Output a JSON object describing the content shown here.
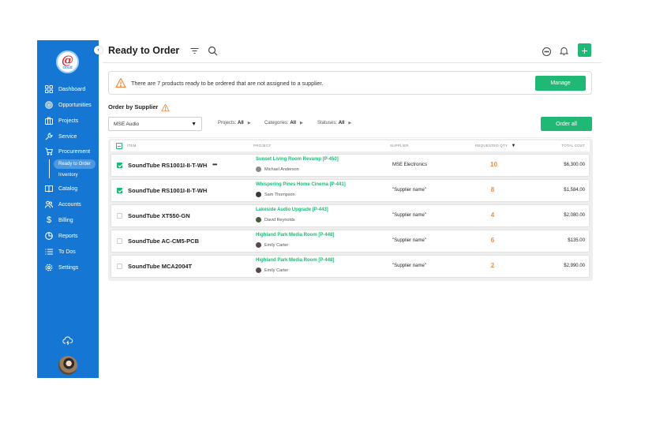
{
  "sidebar": {
    "logo_text": "@",
    "logo_sub": "cloud",
    "collapse_icon": "chevron-left-icon",
    "items": [
      {
        "label": "Dashboard",
        "icon": "grid-icon"
      },
      {
        "label": "Opportunities",
        "icon": "target-icon"
      },
      {
        "label": "Projects",
        "icon": "briefcase-icon"
      },
      {
        "label": "Service",
        "icon": "wrench-icon"
      },
      {
        "label": "Procurement",
        "icon": "cart-icon"
      },
      {
        "label": "Catalog",
        "icon": "book-icon"
      },
      {
        "label": "Accounts",
        "icon": "users-icon"
      },
      {
        "label": "Billing",
        "icon": "dollar-icon"
      },
      {
        "label": "Reports",
        "icon": "pie-chart-icon"
      },
      {
        "label": "To Dos",
        "icon": "list-icon"
      },
      {
        "label": "Settings",
        "icon": "gear-icon"
      }
    ],
    "subitems": [
      {
        "label": "Ready to Order",
        "active": true
      },
      {
        "label": "Inventory",
        "active": false
      }
    ]
  },
  "header": {
    "title": "Ready to Order",
    "add_label": "+"
  },
  "alert": {
    "message": "There are 7 products ready to be ordered that are not assigned to a supplier.",
    "manage_label": "Manage"
  },
  "order_by_supplier": {
    "title": "Order by Supplier",
    "selected_supplier": "MSE Audio",
    "filters": [
      {
        "label": "Projects:",
        "value": "All"
      },
      {
        "label": "Categories:",
        "value": "All"
      },
      {
        "label": "Statuses:",
        "value": "All"
      }
    ],
    "order_all_label": "Order all"
  },
  "table": {
    "columns": [
      "ITEM",
      "PROJECT",
      "SUPPLIER",
      "REQUESTED QTY",
      "TOTAL COST"
    ],
    "rows": [
      {
        "checked": true,
        "item": "SoundTube RS1001I-II-T-WH",
        "more": "•••",
        "project": "Sunset Living Room Revamp [P-450]",
        "person": "Michael Anderson",
        "supplier": "MSE Electronics",
        "qty": "10",
        "cost": "$6,300.00"
      },
      {
        "checked": true,
        "item": "SoundTube RS1001I-II-T-WH",
        "more": "",
        "project": "Whispering Pines Home Cinema [P-441]",
        "person": "Sam Thompson",
        "supplier": "\"Supplier name\"",
        "qty": "8",
        "cost": "$1,584.00"
      },
      {
        "checked": false,
        "item": "SoundTube XT550-GN",
        "more": "",
        "project": "Lakeside Audio Upgrade [P-443]",
        "person": "David Reynolds",
        "supplier": "\"Supplier name\"",
        "qty": "4",
        "cost": "$2,080.00"
      },
      {
        "checked": false,
        "item": "SoundTube AC-CM5-PCB",
        "more": "",
        "project": "Highland Park Media Room [P-448]",
        "person": "Emily Carter",
        "supplier": "\"Supplier name\"",
        "qty": "6",
        "cost": "$135.00"
      },
      {
        "checked": false,
        "item": "SoundTube MCA2004T",
        "more": "",
        "project": "Highland Park Media Room [P-448]",
        "person": "Emily Carter",
        "supplier": "\"Supplier name\"",
        "qty": "2",
        "cost": "$2,990.00"
      }
    ]
  },
  "colors": {
    "sidebar": "#1577d3",
    "accent_green": "#1fb874",
    "qty_orange": "#f5893a",
    "warning_orange": "#f08a3c"
  }
}
